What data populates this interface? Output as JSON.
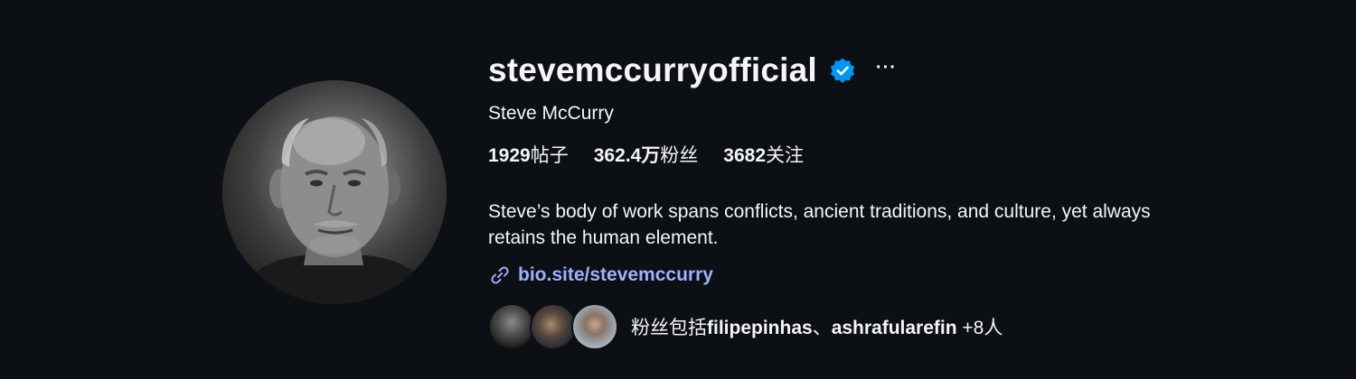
{
  "profile": {
    "username": "stevemccurryofficial",
    "full_name": "Steve McCurry",
    "verified_icon": "verified-badge-icon",
    "more_label": "···",
    "accent_color": "#0095f6",
    "stats": {
      "posts_count": "1929",
      "posts_label": "帖子",
      "followers_count": "362.4万",
      "followers_label": "粉丝",
      "following_count": "3682",
      "following_label": "关注"
    },
    "bio": "Steve’s body of work spans conflicts, ancient traditions, and culture, yet always retains the human element.",
    "link": {
      "icon": "link-icon",
      "text": "bio.site/stevemccurry",
      "color": "#9fb0ff"
    },
    "followed_by": {
      "prefix": "粉丝包括",
      "user1": "filipepinhas",
      "separator": "、",
      "user2": "ashrafularefin",
      "suffix": " +8人"
    }
  }
}
